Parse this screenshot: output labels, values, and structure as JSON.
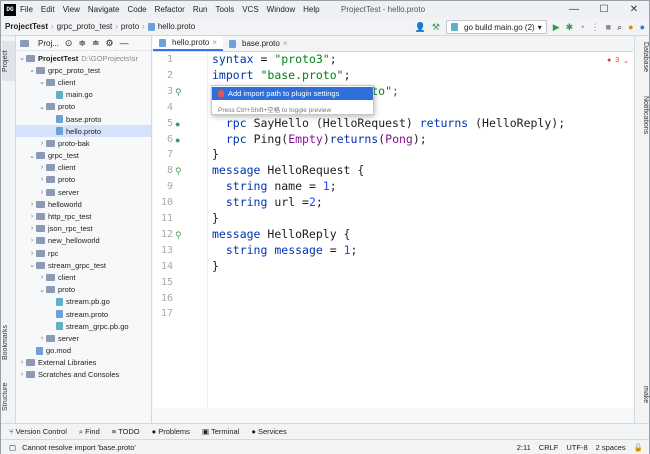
{
  "app": {
    "logo": "DG",
    "window_title": "ProjectTest - hello.proto"
  },
  "menu": [
    "File",
    "Edit",
    "View",
    "Navigate",
    "Code",
    "Refactor",
    "Run",
    "Tools",
    "VCS",
    "Window",
    "Help"
  ],
  "breadcrumb": [
    "ProjectTest",
    "grpc_proto_test",
    "proto",
    "hello.proto"
  ],
  "run_config": "go build main.go (2)",
  "project_panel": {
    "title": "Proj...",
    "root": "ProjectTest",
    "root_path": "D:\\GOProjects\\sr",
    "tree": [
      {
        "label": "grpc_proto_test",
        "depth": 1,
        "type": "folder",
        "open": true
      },
      {
        "label": "client",
        "depth": 2,
        "type": "folder",
        "open": true
      },
      {
        "label": "main.go",
        "depth": 3,
        "type": "go"
      },
      {
        "label": "proto",
        "depth": 2,
        "type": "folder",
        "open": true
      },
      {
        "label": "base.proto",
        "depth": 3,
        "type": "proto"
      },
      {
        "label": "hello.proto",
        "depth": 3,
        "type": "proto",
        "selected": true
      },
      {
        "label": "proto-bak",
        "depth": 2,
        "type": "folder",
        "open": false
      },
      {
        "label": "grpc_test",
        "depth": 1,
        "type": "folder",
        "open": true
      },
      {
        "label": "client",
        "depth": 2,
        "type": "folder",
        "open": false
      },
      {
        "label": "proto",
        "depth": 2,
        "type": "folder",
        "open": false
      },
      {
        "label": "server",
        "depth": 2,
        "type": "folder",
        "open": false
      },
      {
        "label": "helloworld",
        "depth": 1,
        "type": "folder",
        "open": false
      },
      {
        "label": "http_rpc_test",
        "depth": 1,
        "type": "folder",
        "open": false
      },
      {
        "label": "json_rpc_test",
        "depth": 1,
        "type": "folder",
        "open": false
      },
      {
        "label": "new_helloworld",
        "depth": 1,
        "type": "folder",
        "open": false
      },
      {
        "label": "rpc",
        "depth": 1,
        "type": "folder",
        "open": false
      },
      {
        "label": "stream_grpc_test",
        "depth": 1,
        "type": "folder",
        "open": true
      },
      {
        "label": "client",
        "depth": 2,
        "type": "folder",
        "open": false
      },
      {
        "label": "proto",
        "depth": 2,
        "type": "folder",
        "open": true
      },
      {
        "label": "stream.pb.go",
        "depth": 3,
        "type": "go"
      },
      {
        "label": "stream.proto",
        "depth": 3,
        "type": "proto"
      },
      {
        "label": "stream_grpc.pb.go",
        "depth": 3,
        "type": "go"
      },
      {
        "label": "server",
        "depth": 2,
        "type": "folder",
        "open": false
      },
      {
        "label": "go.mod",
        "depth": 1,
        "type": "file"
      },
      {
        "label": "External Libraries",
        "depth": 0,
        "type": "folder",
        "open": false
      },
      {
        "label": "Scratches and Consoles",
        "depth": 0,
        "type": "folder",
        "open": false
      }
    ]
  },
  "tabs": [
    {
      "label": "hello.proto",
      "active": true
    },
    {
      "label": "base.proto",
      "active": false
    }
  ],
  "editor": {
    "error_count": "3",
    "lines": [
      "syntax = \"proto3\";",
      "import \"base.proto\";",
      "                     roto\";",
      "",
      "  rpc SayHello (HelloRequest) returns (HelloReply);",
      "  rpc Ping(Empty)returns(Pong);",
      "}",
      "message HelloRequest {",
      "  string name = 1;",
      "  string url =2;",
      "}",
      "message HelloReply {",
      "  string message = 1;",
      "}",
      "",
      "",
      ""
    ]
  },
  "popup": {
    "action": "Add import path to plugin settings",
    "hint": "Press Ctrl+Shift+空格 to toggle preview"
  },
  "left_tool_windows": [
    "Project",
    "Bookmarks",
    "Structure"
  ],
  "right_tool_windows": [
    "Database",
    "Notifications",
    "make"
  ],
  "bottom_tools": [
    "Version Control",
    "Find",
    "TODO",
    "Problems",
    "Terminal",
    "Services"
  ],
  "status": {
    "message": "Cannot resolve import 'base.proto'",
    "position": "2:11",
    "line_sep": "CRLF",
    "encoding": "UTF-8",
    "indent": "2 spaces"
  }
}
